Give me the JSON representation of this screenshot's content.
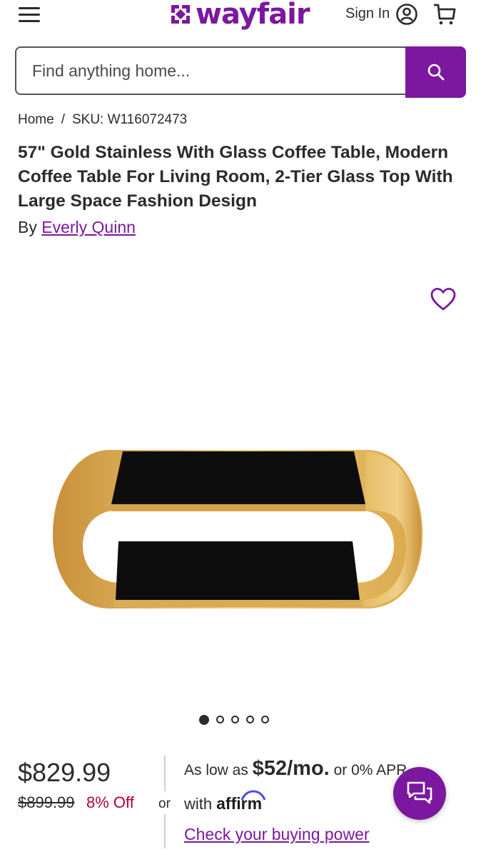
{
  "header": {
    "logo_text": "wayfair",
    "sign_in_label": "Sign In"
  },
  "search": {
    "placeholder": "Find anything home..."
  },
  "breadcrumb": {
    "home": "Home",
    "separator": "/",
    "sku": "SKU: W116072473"
  },
  "product": {
    "title": "57\" Gold Stainless With Glass Coffee Table, Modern Coffee Table For Living Room, 2-Tier Glass Top With Large Space Fashion Design",
    "brand_prefix": "By",
    "brand_name": "Everly Quinn"
  },
  "gallery": {
    "total_images": 5,
    "active_index": 0
  },
  "pricing": {
    "price": "$829.99",
    "was_price": "$899.99",
    "discount": "8% Off",
    "or_label": "or",
    "affirm_prefix": "As low as",
    "affirm_amount": "$52/mo.",
    "affirm_suffix": "or 0% APR",
    "affirm_with": "with",
    "affirm_brand": "affirm",
    "buying_power_link": "Check your buying power"
  },
  "colors": {
    "brand_purple": "#7b189f",
    "sale_red": "#b0003a",
    "gold": "#d9a84a",
    "glass_black": "#0d0d0d"
  },
  "icons": [
    "menu-icon",
    "account-icon",
    "cart-icon",
    "search-icon",
    "heart-icon",
    "chat-icon"
  ]
}
